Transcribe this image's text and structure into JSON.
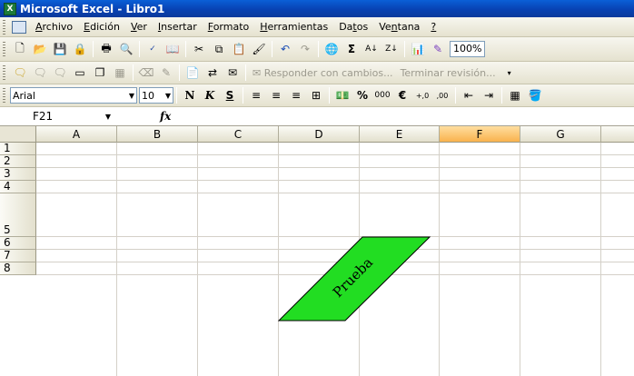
{
  "window": {
    "title": "Microsoft Excel - Libro1",
    "logo": "X"
  },
  "menu": {
    "items": [
      {
        "pre": "",
        "u": "A",
        "post": "rchivo"
      },
      {
        "pre": "",
        "u": "E",
        "post": "dición"
      },
      {
        "pre": "",
        "u": "V",
        "post": "er"
      },
      {
        "pre": "",
        "u": "I",
        "post": "nsertar"
      },
      {
        "pre": "",
        "u": "F",
        "post": "ormato"
      },
      {
        "pre": "",
        "u": "H",
        "post": "erramientas"
      },
      {
        "pre": "Da",
        "u": "t",
        "post": "os"
      },
      {
        "pre": "Ve",
        "u": "n",
        "post": "tana"
      },
      {
        "pre": "",
        "u": "?",
        "post": ""
      }
    ]
  },
  "standard_toolbar": {
    "zoom": "100%",
    "sigma": "Σ"
  },
  "reviewing_toolbar": {
    "reply_label": "Responder con cambios...",
    "end_review_label": "Terminar revisión..."
  },
  "formatting_toolbar": {
    "font": "Arial",
    "size": "10",
    "bold": "N",
    "italic": "K",
    "underline": "S",
    "percent": "%",
    "thousands": "000",
    "euro": "€",
    "inc_dec": "+,0",
    "dec_dec": ",00"
  },
  "formula_bar": {
    "name_box": "F21",
    "fx": "fx",
    "content": ""
  },
  "sheet": {
    "columns": [
      "A",
      "B",
      "C",
      "D",
      "E",
      "F",
      "G"
    ],
    "selected_column": "F",
    "rows": [
      "1",
      "2",
      "3",
      "4",
      "5",
      "6",
      "7",
      "8"
    ],
    "shape": {
      "text": "Prueba",
      "fill": "#22dd22",
      "stroke": "#000000"
    }
  }
}
